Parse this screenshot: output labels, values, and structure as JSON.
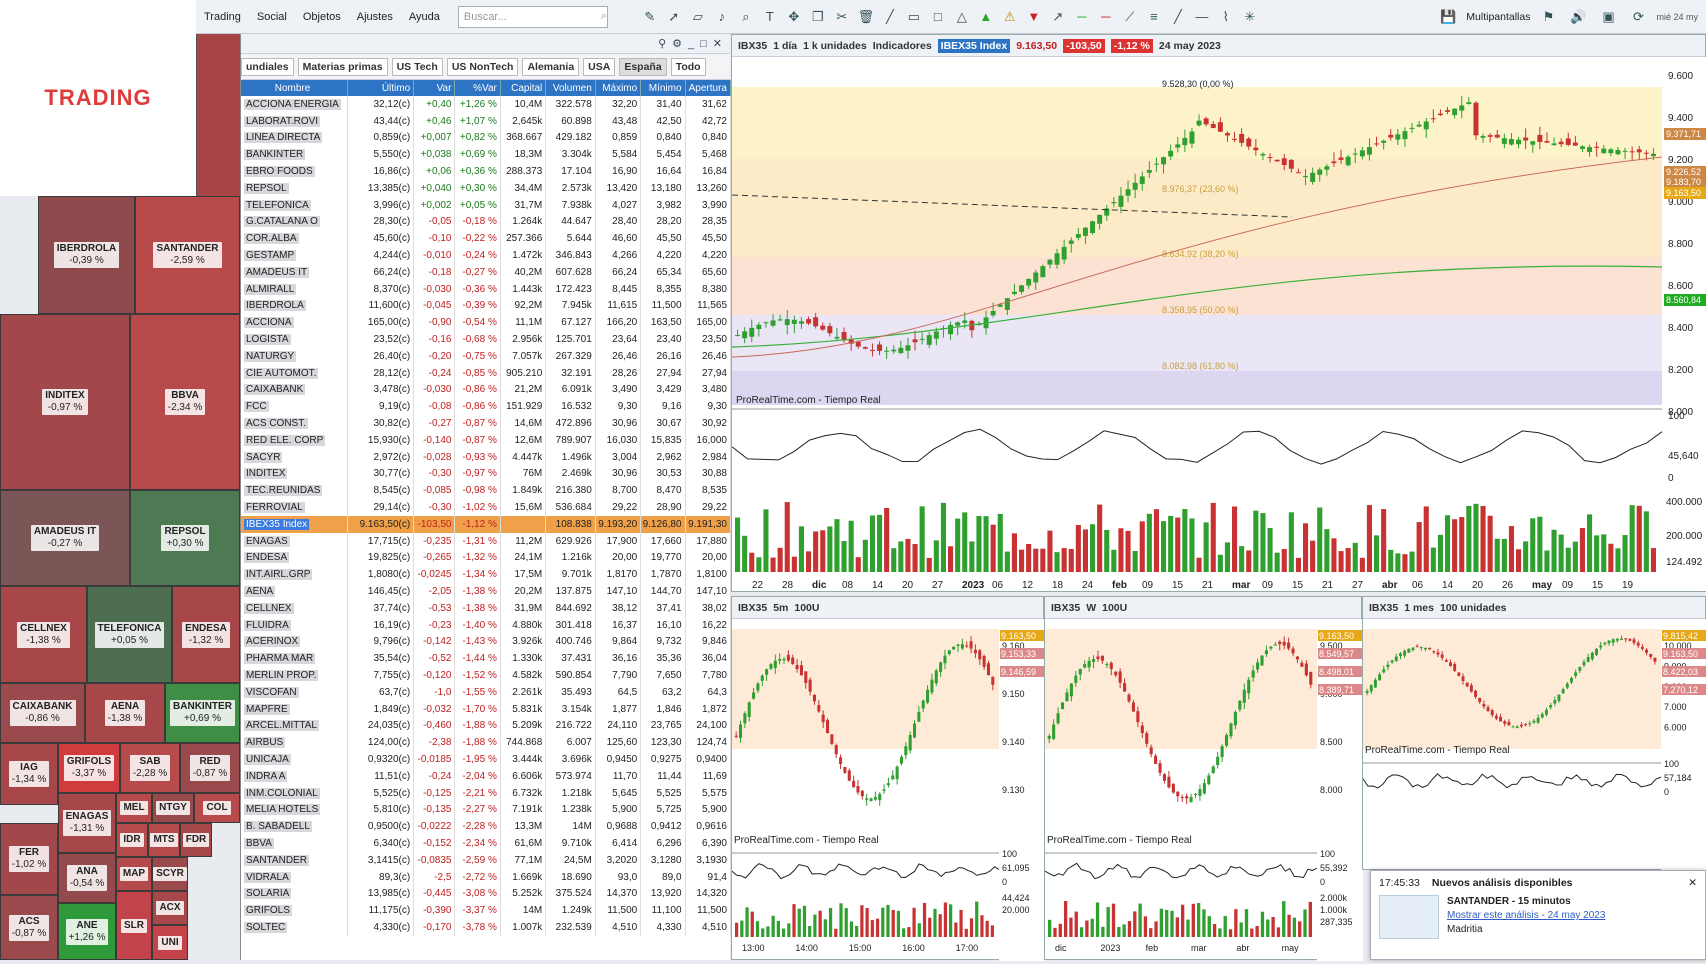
{
  "logo": "TRADING",
  "menu": [
    "Trading",
    "Social",
    "Objetos",
    "Ajustes",
    "Ayuda"
  ],
  "search_placeholder": "Buscar...",
  "multipantallas": "Multipantallas",
  "clock": "mié 24 my",
  "tabs": [
    "undiales",
    "Materias primas",
    "US Tech",
    "US NonTech",
    "Alemania",
    "USA",
    "España",
    "Todo"
  ],
  "list_headers": [
    "Nombre",
    "Último",
    "Var",
    "%Var",
    "Capital",
    "Volumen",
    "Máximo",
    "Mínimo",
    "Apertura"
  ],
  "rows": [
    [
      "ACCIONA ENERGIA",
      "32,12(c)",
      "+0,40",
      "+1,26 %",
      "10,4M",
      "322.578",
      "32,20",
      "31,40",
      "31,62"
    ],
    [
      "LABORAT.ROVI",
      "43,44(c)",
      "+0,46",
      "+1,07 %",
      "2,645k",
      "60.898",
      "43,48",
      "42,50",
      "42,72"
    ],
    [
      "LINEA DIRECTA",
      "0,859(c)",
      "+0,007",
      "+0,82 %",
      "368.667",
      "429.182",
      "0,859",
      "0,840",
      "0,840"
    ],
    [
      "BANKINTER",
      "5,550(c)",
      "+0,038",
      "+0,69 %",
      "18,3M",
      "3.304k",
      "5,584",
      "5,454",
      "5,468"
    ],
    [
      "EBRO FOODS",
      "16,86(c)",
      "+0,06",
      "+0,36 %",
      "288.373",
      "17.104",
      "16,90",
      "16,64",
      "16,84"
    ],
    [
      "REPSOL",
      "13,385(c)",
      "+0,040",
      "+0,30 %",
      "34,4M",
      "2.573k",
      "13,420",
      "13,180",
      "13,260"
    ],
    [
      "TELEFONICA",
      "3,996(c)",
      "+0,002",
      "+0,05 %",
      "31,7M",
      "7.938k",
      "4,027",
      "3,982",
      "3,990"
    ],
    [
      "G.CATALANA O",
      "28,30(c)",
      "-0,05",
      "-0,18 %",
      "1.264k",
      "44.647",
      "28,40",
      "28,20",
      "28,35"
    ],
    [
      "COR.ALBA",
      "45,60(c)",
      "-0,10",
      "-0,22 %",
      "257.366",
      "5.644",
      "46,60",
      "45,50",
      "45,50"
    ],
    [
      "GESTAMP",
      "4,244(c)",
      "-0,010",
      "-0,24 %",
      "1.472k",
      "346.843",
      "4,266",
      "4,220",
      "4,220"
    ],
    [
      "AMADEUS IT",
      "66,24(c)",
      "-0,18",
      "-0,27 %",
      "40,2M",
      "607.628",
      "66,24",
      "65,34",
      "65,60"
    ],
    [
      "ALMIRALL",
      "8,370(c)",
      "-0,030",
      "-0,36 %",
      "1.443k",
      "172.423",
      "8,445",
      "8,355",
      "8,380"
    ],
    [
      "IBERDROLA",
      "11,600(c)",
      "-0,045",
      "-0,39 %",
      "92,2M",
      "7.945k",
      "11,615",
      "11,500",
      "11,565"
    ],
    [
      "ACCIONA",
      "165,00(c)",
      "-0,90",
      "-0,54 %",
      "11,1M",
      "67.127",
      "166,20",
      "163,50",
      "165,00"
    ],
    [
      "LOGISTA",
      "23,52(c)",
      "-0,16",
      "-0,68 %",
      "2.956k",
      "125.701",
      "23,64",
      "23,40",
      "23,50"
    ],
    [
      "NATURGY",
      "26,40(c)",
      "-0,20",
      "-0,75 %",
      "7.057k",
      "267.329",
      "26,46",
      "26,16",
      "26,46"
    ],
    [
      "CIE AUTOMOT.",
      "28,12(c)",
      "-0,24",
      "-0,85 %",
      "905.210",
      "32.191",
      "28,26",
      "27,94",
      "27,94"
    ],
    [
      "CAIXABANK",
      "3,478(c)",
      "-0,030",
      "-0,86 %",
      "21,2M",
      "6.091k",
      "3,490",
      "3,429",
      "3,480"
    ],
    [
      "FCC",
      "9,19(c)",
      "-0,08",
      "-0,86 %",
      "151.929",
      "16.532",
      "9,30",
      "9,16",
      "9,30"
    ],
    [
      "ACS CONST.",
      "30,82(c)",
      "-0,27",
      "-0,87 %",
      "14,6M",
      "472.896",
      "30,96",
      "30,67",
      "30,92"
    ],
    [
      "RED ELE. CORP",
      "15,930(c)",
      "-0,140",
      "-0,87 %",
      "12,6M",
      "789.907",
      "16,030",
      "15,835",
      "16,000"
    ],
    [
      "SACYR",
      "2,972(c)",
      "-0,028",
      "-0,93 %",
      "4.447k",
      "1.496k",
      "3,004",
      "2,962",
      "2,984"
    ],
    [
      "INDITEX",
      "30,77(c)",
      "-0,30",
      "-0,97 %",
      "76M",
      "2.469k",
      "30,96",
      "30,53",
      "30,88"
    ],
    [
      "TEC.REUNIDAS",
      "8,545(c)",
      "-0,085",
      "-0,98 %",
      "1.849k",
      "216.380",
      "8,700",
      "8,470",
      "8,535"
    ],
    [
      "FERROVIAL",
      "29,14(c)",
      "-0,30",
      "-1,02 %",
      "15,6M",
      "536.684",
      "29,22",
      "28,90",
      "29,22"
    ],
    [
      "IBEX35 Index",
      "9.163,50(c)",
      "-103,50",
      "-1,12 %",
      "",
      "108.838",
      "9.193,20",
      "9.126,80",
      "9.191,30"
    ],
    [
      "ENAGAS",
      "17,715(c)",
      "-0,235",
      "-1,31 %",
      "11,2M",
      "629.926",
      "17,900",
      "17,660",
      "17,880"
    ],
    [
      "ENDESA",
      "19,825(c)",
      "-0,265",
      "-1,32 %",
      "24,1M",
      "1.216k",
      "20,00",
      "19,770",
      "20,00"
    ],
    [
      "INT.AIRL.GRP",
      "1,8080(c)",
      "-0,0245",
      "-1,34 %",
      "17,5M",
      "9.701k",
      "1,8170",
      "1,7870",
      "1,8100"
    ],
    [
      "AENA",
      "146,45(c)",
      "-2,05",
      "-1,38 %",
      "20,2M",
      "137.875",
      "147,10",
      "144,70",
      "147,10"
    ],
    [
      "CELLNEX",
      "37,74(c)",
      "-0,53",
      "-1,38 %",
      "31,9M",
      "844.692",
      "38,12",
      "37,41",
      "38,02"
    ],
    [
      "FLUIDRA",
      "16,19(c)",
      "-0,23",
      "-1,40 %",
      "4.880k",
      "301.418",
      "16,37",
      "16,10",
      "16,22"
    ],
    [
      "ACERINOX",
      "9,796(c)",
      "-0,142",
      "-1,43 %",
      "3.926k",
      "400.746",
      "9,864",
      "9,732",
      "9,846"
    ],
    [
      "PHARMA MAR",
      "35,54(c)",
      "-0,52",
      "-1,44 %",
      "1.330k",
      "37.431",
      "36,16",
      "35,36",
      "36,04"
    ],
    [
      "MERLIN PROP.",
      "7,755(c)",
      "-0,120",
      "-1,52 %",
      "4.582k",
      "590.854",
      "7,790",
      "7,650",
      "7,780"
    ],
    [
      "VISCOFAN",
      "63,7(c)",
      "-1,0",
      "-1,55 %",
      "2.261k",
      "35.493",
      "64,5",
      "63,2",
      "64,3"
    ],
    [
      "MAPFRE",
      "1,849(c)",
      "-0,032",
      "-1,70 %",
      "5.831k",
      "3.154k",
      "1,877",
      "1,846",
      "1,872"
    ],
    [
      "ARCEL.MITTAL",
      "24,035(c)",
      "-0,460",
      "-1,88 %",
      "5.209k",
      "216.722",
      "24,110",
      "23,765",
      "24,100"
    ],
    [
      "AIRBUS",
      "124,00(c)",
      "-2,38",
      "-1,88 %",
      "744.868",
      "6.007",
      "125,60",
      "123,30",
      "124,74"
    ],
    [
      "UNICAJA",
      "0,9320(c)",
      "-0,0185",
      "-1,95 %",
      "3.444k",
      "3.696k",
      "0,9450",
      "0,9275",
      "0,9400"
    ],
    [
      "INDRA A",
      "11,51(c)",
      "-0,24",
      "-2,04 %",
      "6.606k",
      "573.974",
      "11,70",
      "11,44",
      "11,69"
    ],
    [
      "INM.COLONIAL",
      "5,525(c)",
      "-0,125",
      "-2,21 %",
      "6.732k",
      "1.218k",
      "5,645",
      "5,525",
      "5,575"
    ],
    [
      "MELIA HOTELS",
      "5,810(c)",
      "-0,135",
      "-2,27 %",
      "7.191k",
      "1.238k",
      "5,900",
      "5,725",
      "5,900"
    ],
    [
      "B. SABADELL",
      "0,9500(c)",
      "-0,0222",
      "-2,28 %",
      "13,3M",
      "14M",
      "0,9688",
      "0,9412",
      "0,9616"
    ],
    [
      "BBVA",
      "6,340(c)",
      "-0,152",
      "-2,34 %",
      "61,6M",
      "9.710k",
      "6,414",
      "6,296",
      "6,390"
    ],
    [
      "SANTANDER",
      "3,1415(c)",
      "-0,0835",
      "-2,59 %",
      "77,1M",
      "24,5M",
      "3,2020",
      "3,1280",
      "3,1930"
    ],
    [
      "VIDRALA",
      "89,3(c)",
      "-2,5",
      "-2,72 %",
      "1.669k",
      "18.690",
      "93,0",
      "89,0",
      "91,4"
    ],
    [
      "SOLARIA",
      "13,985(c)",
      "-0,445",
      "-3,08 %",
      "5.252k",
      "375.524",
      "14,370",
      "13,920",
      "14,320"
    ],
    [
      "GRIFOLS",
      "11,175(c)",
      "-0,390",
      "-3,37 %",
      "14M",
      "1.249k",
      "11,500",
      "11,100",
      "11,500"
    ],
    [
      "SOLTEC",
      "4,330(c)",
      "-0,170",
      "-3,78 %",
      "1.007k",
      "232.539",
      "4,510",
      "4,330",
      "4,510"
    ]
  ],
  "heatmap": [
    {
      "n": "IBERDROLA",
      "v": "-0,39 %",
      "c": "#8e4a4c"
    },
    {
      "n": "SANTANDER",
      "v": "-2,59 %",
      "c": "#b94a4c"
    },
    {
      "n": "INDITEX",
      "v": "-0,97 %",
      "c": "#a2484a"
    },
    {
      "n": "BBVA",
      "v": "-2,34 %",
      "c": "#b94a4c"
    },
    {
      "n": "AMADEUS IT",
      "v": "-0,27 %",
      "c": "#7c5556"
    },
    {
      "n": "REPSOL",
      "v": "+0,30 %",
      "c": "#4d7a53"
    },
    {
      "n": "CELLNEX",
      "v": "-1,38 %",
      "c": "#a8474a"
    },
    {
      "n": "TELEFONICA",
      "v": "+0,05 %",
      "c": "#4e6e52"
    },
    {
      "n": "ENDESA",
      "v": "-1,32 %",
      "c": "#a8474a"
    },
    {
      "n": "CAIXABANK",
      "v": "-0,86 %",
      "c": "#9a4a4c"
    },
    {
      "n": "AENA",
      "v": "-1,38 %",
      "c": "#a8474a"
    },
    {
      "n": "BANKINTER",
      "v": "+0,69 %",
      "c": "#3f8e46"
    },
    {
      "n": "IAG",
      "v": "-1,34 %",
      "c": "#a8474a"
    },
    {
      "n": "GRIFOLS",
      "v": "-3,37 %",
      "c": "#d03b3e"
    },
    {
      "n": "SAB",
      "v": "-2,28 %",
      "c": "#b94a4c"
    },
    {
      "n": "RED",
      "v": "-0,87 %",
      "c": "#9a4a4c"
    },
    {
      "n": "ENAGAS",
      "v": "-1,31 %",
      "c": "#a8474a"
    },
    {
      "n": "MEL",
      "v": "",
      "c": "#b94a4c"
    },
    {
      "n": "NTGY",
      "v": "",
      "c": "#9a4a4c"
    },
    {
      "n": "COL",
      "v": "",
      "c": "#b94a4c"
    },
    {
      "n": "FER",
      "v": "-1,02 %",
      "c": "#a2484a"
    },
    {
      "n": "IDR",
      "v": "",
      "c": "#b54a4c"
    },
    {
      "n": "MTS",
      "v": "",
      "c": "#b54a4c"
    },
    {
      "n": "FDR",
      "v": "",
      "c": "#a8474a"
    },
    {
      "n": "ANA",
      "v": "-0,54 %",
      "c": "#944a4c"
    },
    {
      "n": "MAP",
      "v": "",
      "c": "#b54a4c"
    },
    {
      "n": "SCYR",
      "v": "",
      "c": "#9a4a4c"
    },
    {
      "n": "ACS",
      "v": "-0,87 %",
      "c": "#9a4a4c"
    },
    {
      "n": "ACX",
      "v": "",
      "c": "#a8474a"
    },
    {
      "n": "ANE",
      "v": "+1,26 %",
      "c": "#2e9a3a"
    },
    {
      "n": "SLR",
      "v": "",
      "c": "#c2444a"
    },
    {
      "n": "UNI",
      "v": "",
      "c": "#c2444a"
    }
  ],
  "main_chart": {
    "symbol": "IBX35",
    "period": "1 día",
    "units": "1 k unidades",
    "indicators": "Indicadores",
    "badge_name": "IBEX35 Index",
    "price": "9.163,50",
    "change": "-103,50",
    "pct": "-1,12 %",
    "date": "24 may 2023",
    "watermark": "ProRealTime.com - Tiempo Real",
    "top_label": "9.528,30 (0,00 %)",
    "fibs": [
      "8.976,37 (23,60 %)",
      "8.634,92 (38,20 %)",
      "8.358,95 (50,00 %)",
      "8.082,98 (61,80 %)"
    ],
    "yticks": [
      "9.600",
      "9.400",
      "9.200",
      "9.000",
      "8.800",
      "8.600",
      "8.400",
      "8.200",
      "8.000"
    ],
    "osc_ticks": [
      "100",
      "45,640",
      "0"
    ],
    "vol_ticks": [
      "400.000",
      "200.000"
    ],
    "vol_last": "124.492",
    "xticks": [
      "22",
      "28",
      "dic",
      "08",
      "14",
      "20",
      "27",
      "2023",
      "06",
      "12",
      "18",
      "24",
      "feb",
      "09",
      "15",
      "21",
      "mar",
      "09",
      "15",
      "21",
      "27",
      "abr",
      "06",
      "14",
      "20",
      "26",
      "may",
      "09",
      "15",
      "19"
    ],
    "price_tags": [
      "9.371,71",
      "9.226,52",
      "9.183,70",
      "9.163,50",
      "8.560,84"
    ]
  },
  "mini1": {
    "symbol": "IBX35",
    "period": "5m",
    "units": "100U",
    "watermark": "ProRealTime.com - Tiempo Real",
    "yticks": [
      "9.160",
      "9.150",
      "9.140",
      "9.130"
    ],
    "tags": [
      "9.163,50",
      "9.153,33",
      "9.146,59"
    ],
    "osc": [
      "100",
      "61,095",
      "0"
    ],
    "vol": [
      "44,424",
      "20.000"
    ],
    "xticks": [
      "13:00",
      "14:00",
      "15:00",
      "16:00",
      "17:00"
    ]
  },
  "mini2": {
    "symbol": "IBX35",
    "period": "W",
    "units": "100U",
    "watermark": "ProRealTime.com - Tiempo Real",
    "yticks": [
      "9.500",
      "9.000",
      "8.500",
      "8.000"
    ],
    "tags": [
      "9.163,50",
      "8.549,57",
      "8.498,01",
      "8.389,71"
    ],
    "osc": [
      "100",
      "55,392",
      "0"
    ],
    "vol": [
      "2.000k",
      "1.000k",
      "287,335"
    ],
    "xticks": [
      "dic",
      "2023",
      "feb",
      "mar",
      "abr",
      "may"
    ]
  },
  "mini3": {
    "symbol": "IBX35",
    "period": "1 mes",
    "units": "100 unidades",
    "watermark": "ProRealTime.com - Tiempo Real",
    "yticks": [
      "10.000",
      "9.000",
      "8.000",
      "7.000",
      "6.000"
    ],
    "tags": [
      "9.815,42",
      "9.163,50",
      "8.422,03",
      "7.270,12"
    ],
    "osc": [
      "100",
      "57,184",
      "0"
    ]
  },
  "notification": {
    "time": "17:45:33",
    "title": "Nuevos análisis disponibles",
    "asset": "SANTANDER - 15 minutos",
    "link": "Mostrar este análisis - 24 may 2023",
    "author": "Madritia"
  },
  "colors": {
    "up": "#2fa02f",
    "down": "#c83232",
    "accent": "#2e74c4",
    "selected": "#f0a048"
  }
}
